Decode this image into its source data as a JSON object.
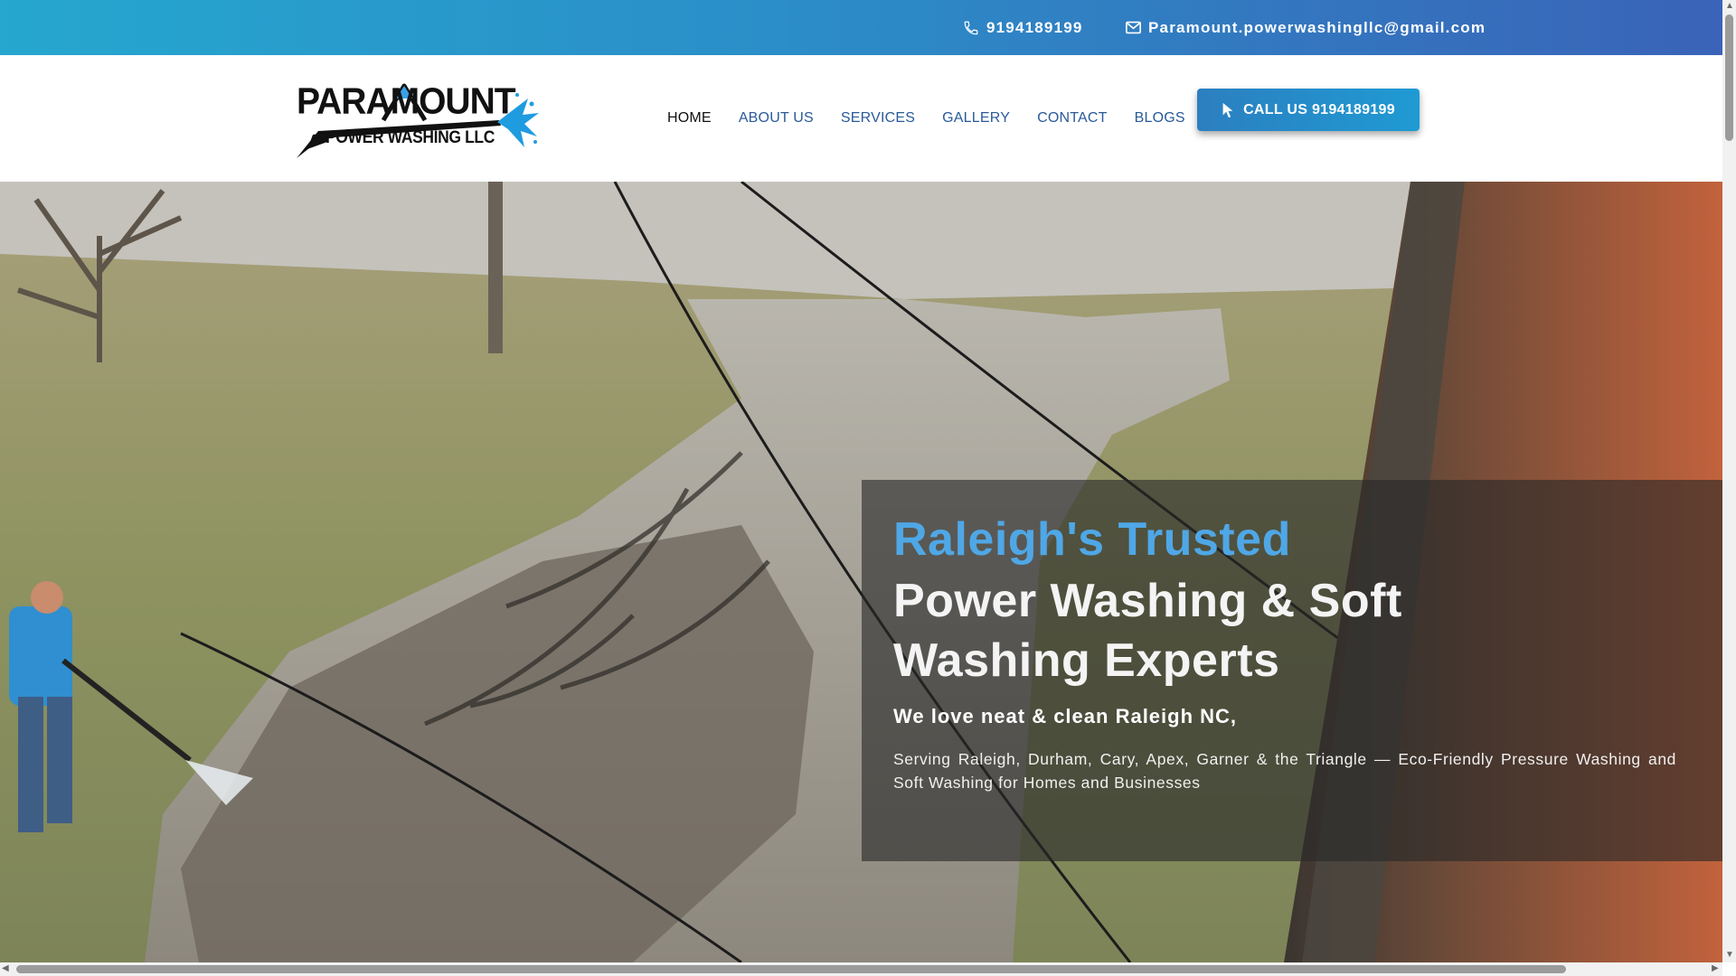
{
  "topbar": {
    "phone": "9194189199",
    "email": "Paramount.powerwashingllc@gmail.com",
    "phone_icon": "phone-icon",
    "email_icon": "mail-icon"
  },
  "logo": {
    "line1": "PARAMOUNT",
    "line2": "POWER WASHING LLC"
  },
  "nav": {
    "items": [
      {
        "label": "HOME",
        "active": true
      },
      {
        "label": "ABOUT US"
      },
      {
        "label": "SERVICES"
      },
      {
        "label": "GALLERY"
      },
      {
        "label": "CONTACT"
      },
      {
        "label": "BLOGS"
      }
    ]
  },
  "cta": {
    "label": "CALL US 9194189199",
    "icon": "cursor-icon"
  },
  "hero": {
    "headline_accent": "Raleigh's Trusted",
    "headline_main": "Power Washing & Soft Washing Experts",
    "tagline": "We love neat & clean Raleigh NC,",
    "description": "Serving Raleigh, Durham, Cary, Apex, Garner & the Triangle — Eco-Friendly Pressure Washing and Soft Washing for Homes and Businesses"
  },
  "colors": {
    "topbar_start": "#25a7cf",
    "topbar_end": "#3a63b8",
    "nav_link": "#2a5a98",
    "accent_blue": "#4fa7e6",
    "cta_button": "#2c7fc0"
  }
}
